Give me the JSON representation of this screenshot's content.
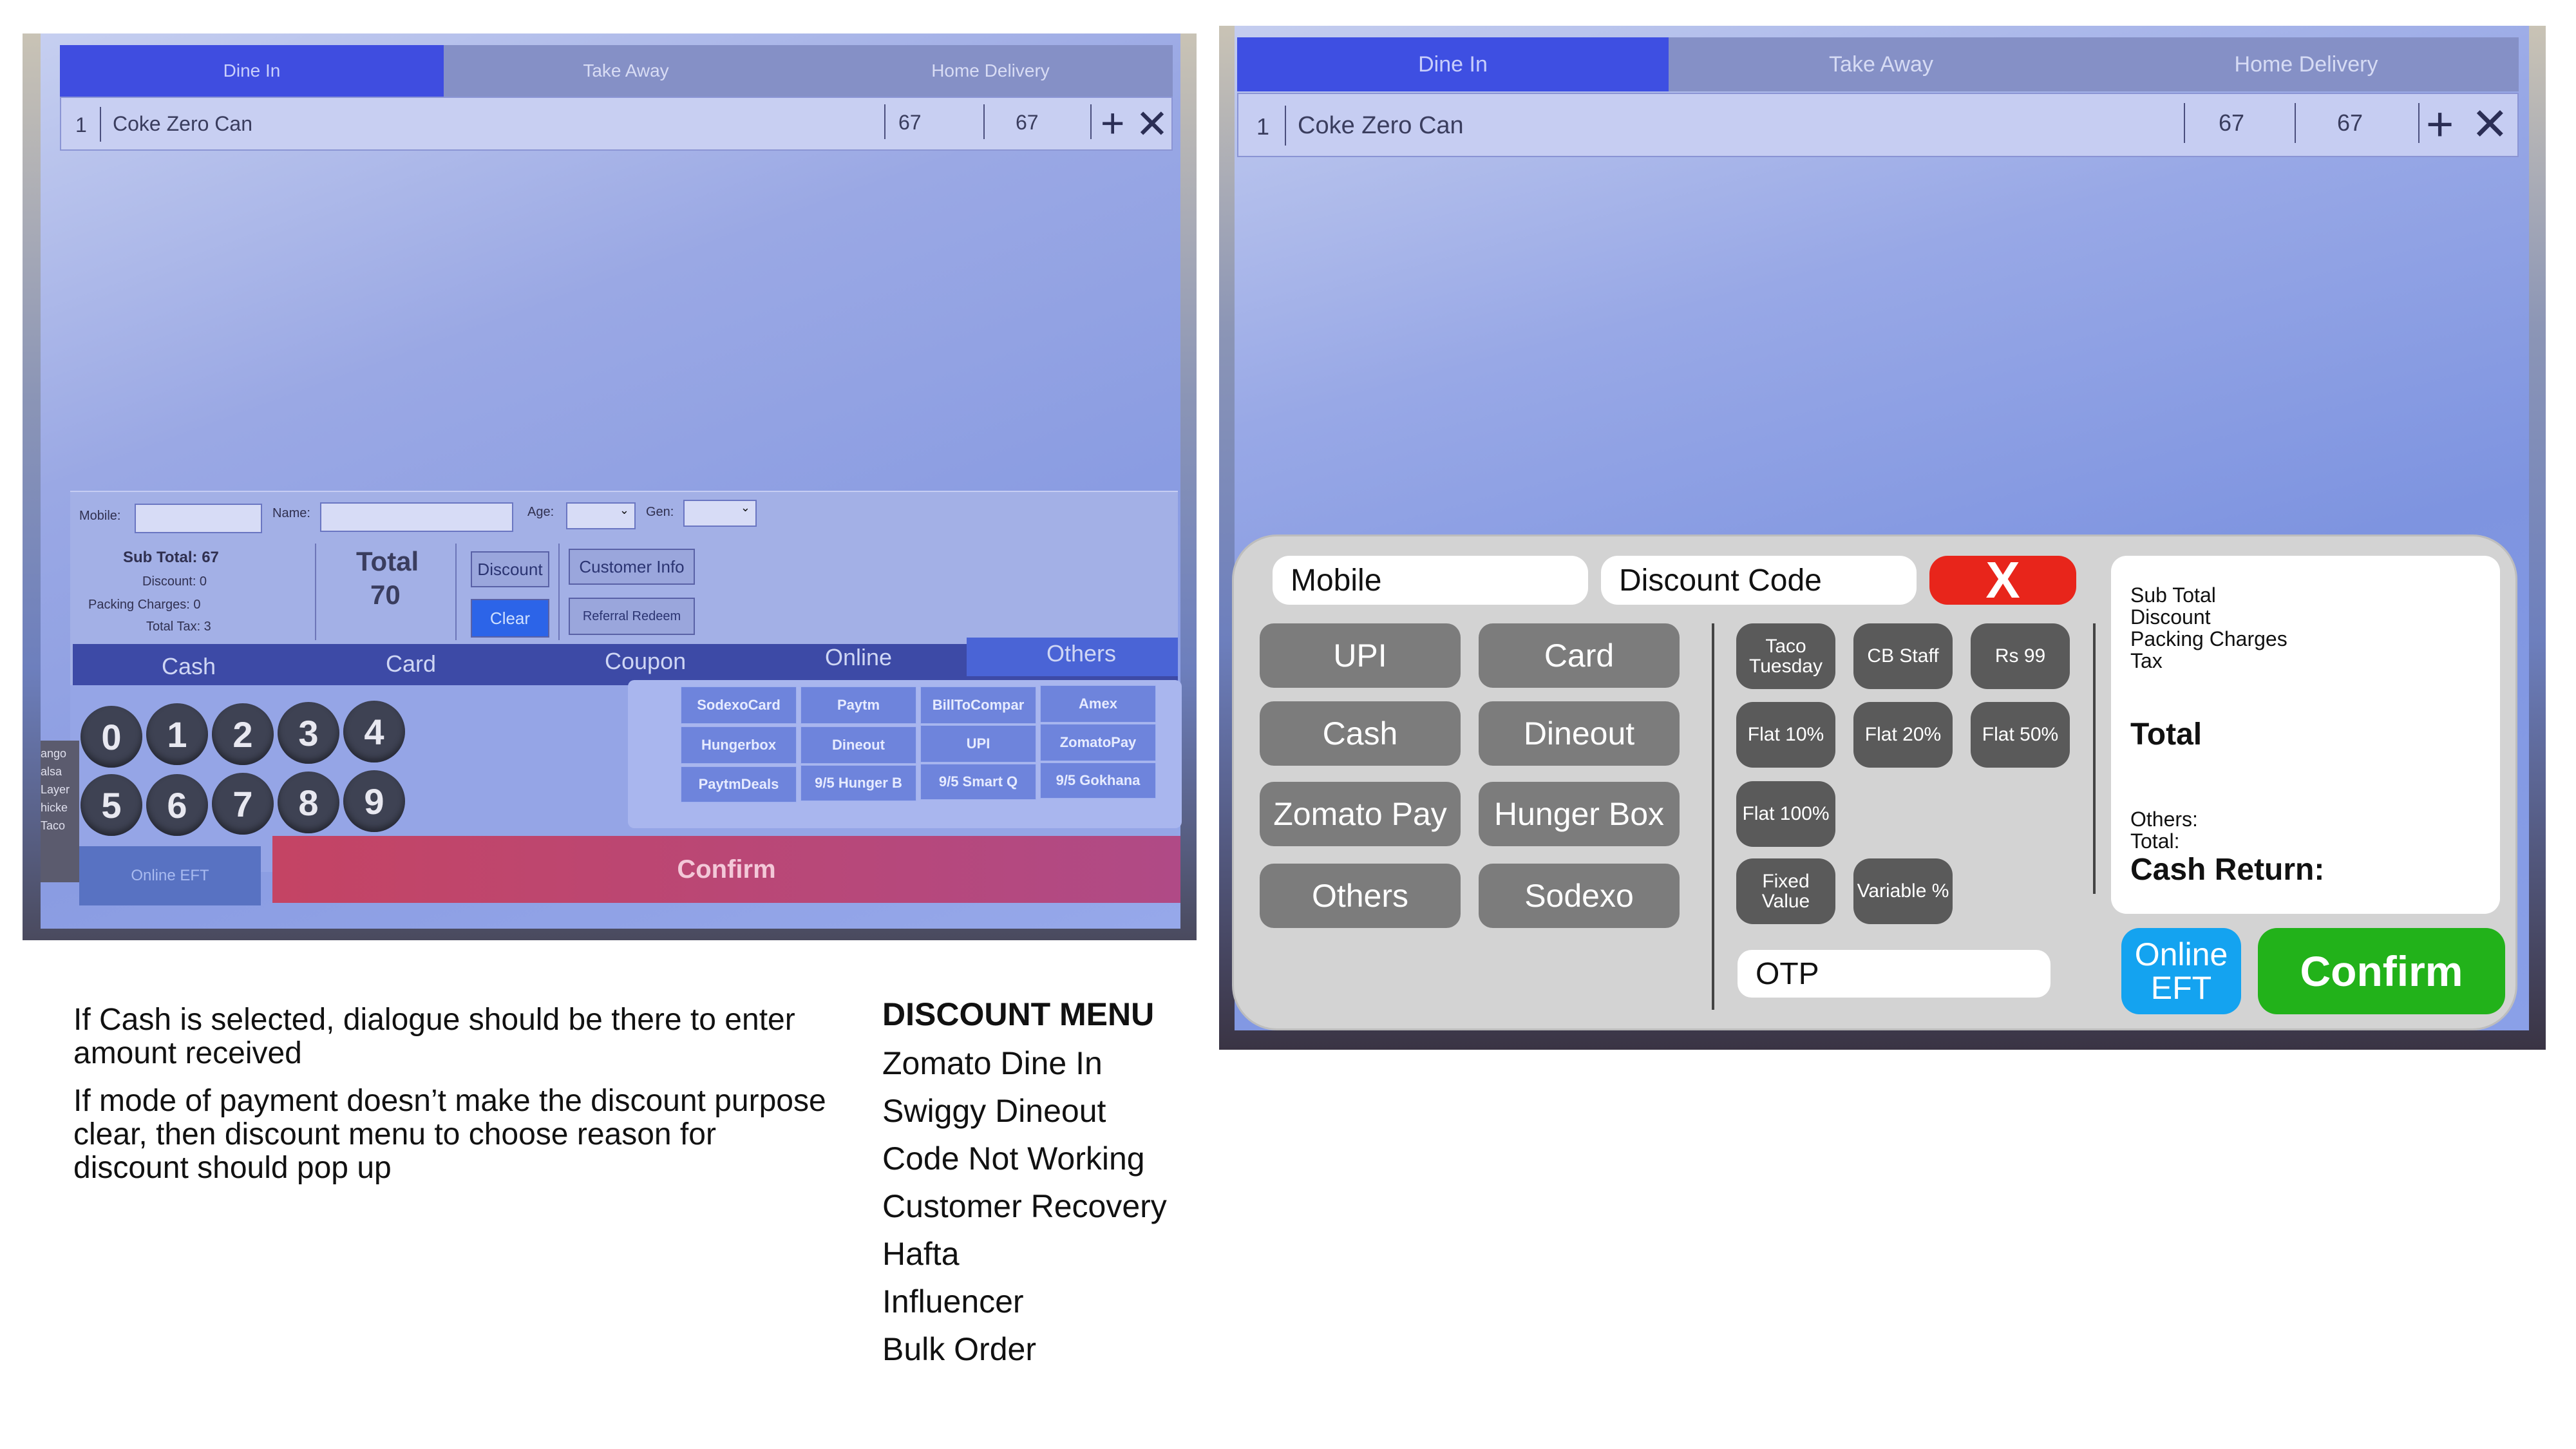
{
  "existing_pos": {
    "order_tabs": [
      "Dine In",
      "Take Away",
      "Home Delivery"
    ],
    "order_item": {
      "qty": "1",
      "name": "Coke Zero Can",
      "price": "67",
      "amount": "67"
    },
    "customer": {
      "mobile_label": "Mobile:",
      "name_label": "Name:",
      "age_label": "Age:",
      "gen_label": "Gen:"
    },
    "summary": {
      "sub_total": "Sub Total: 67",
      "discount": "Discount: 0",
      "packing": "Packing Charges: 0",
      "tax": "Total Tax: 3",
      "total_label": "Total",
      "total_value": "70"
    },
    "buttons": {
      "discount": "Discount",
      "customer_info": "Customer Info",
      "clear": "Clear",
      "referral": "Referral Redeem",
      "online_eft": "Online EFT",
      "confirm": "Confirm"
    },
    "payment_tabs": [
      "Cash",
      "Card",
      "Coupon",
      "Online",
      "Others"
    ],
    "numpad": [
      "0",
      "1",
      "2",
      "3",
      "4",
      "5",
      "6",
      "7",
      "8",
      "9"
    ],
    "side_labels": [
      "ango",
      "alsa",
      "Layer",
      "hicke",
      "Taco"
    ],
    "other_options": [
      "SodexoCard",
      "Paytm",
      "BillToCompar",
      "Amex",
      "Hungerbox",
      "Dineout",
      "UPI",
      "ZomatoPay",
      "PaytmDeals",
      "9/5 Hunger B",
      "9/5 Smart Q",
      "9/5 Gokhana"
    ]
  },
  "proposed_pos": {
    "order_tabs": [
      "Dine In",
      "Take Away",
      "Home Delivery"
    ],
    "order_item": {
      "qty": "1",
      "name": "Coke Zero Can",
      "price": "67",
      "amount": "67"
    },
    "mobile_placeholder": "Mobile",
    "discount_code_placeholder": "Discount Code",
    "close_label": "X",
    "payment_methods": [
      "UPI",
      "Card",
      "Cash",
      "Dineout",
      "Zomato Pay",
      "Hunger Box",
      "Others",
      "Sodexo"
    ],
    "discounts": [
      "Taco Tuesday",
      "CB Staff",
      "Rs 99",
      "Flat 10%",
      "Flat 20%",
      "Flat 50%",
      "Flat 100%",
      "Fixed Value",
      "Variable %"
    ],
    "otp_placeholder": "OTP",
    "summary": {
      "sub_total": "Sub Total",
      "discount": "Discount",
      "packing": "Packing Charges",
      "tax": "Tax",
      "total": "Total",
      "others": "Others:",
      "total_small": "Total:",
      "cash_return": "Cash Return:"
    },
    "online_eft": "Online EFT",
    "confirm": "Confirm",
    "colors": {
      "close": "#e8251b",
      "online_eft": "#14a3f0",
      "confirm": "#22b21a",
      "panel": "#d3d3d3",
      "method_button": "#7c7c7c",
      "discount_button": "#5a5a5a"
    }
  },
  "notes": {
    "cash_note": "If Cash is selected, dialogue should be there to enter amount received",
    "discount_note": "If mode of payment doesn’t make the discount purpose clear, then discount menu to choose reason for discount should pop up"
  },
  "discount_menu": {
    "title": "DISCOUNT MENU",
    "items": [
      "Zomato Dine In",
      "Swiggy Dineout",
      "Code Not Working",
      "Customer Recovery",
      "Hafta",
      "Influencer",
      "Bulk Order"
    ]
  }
}
